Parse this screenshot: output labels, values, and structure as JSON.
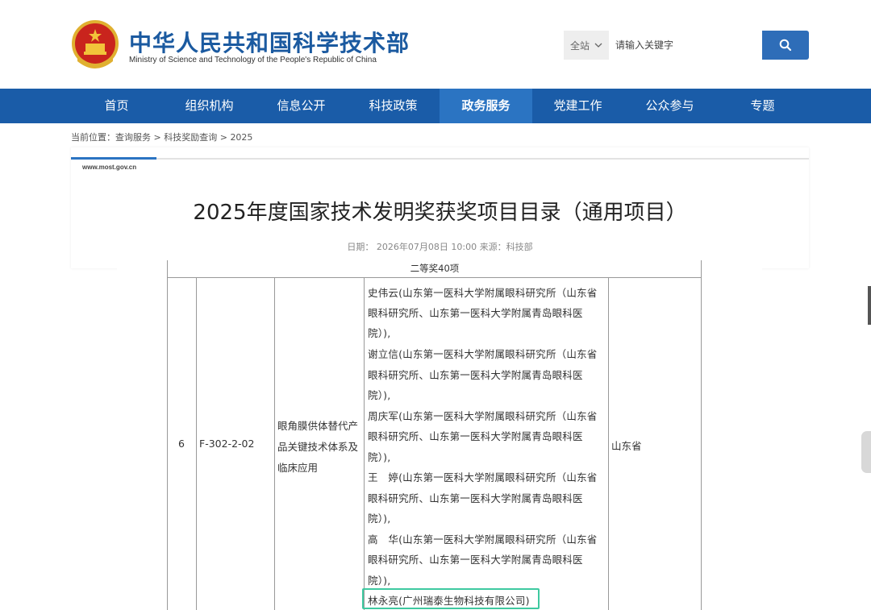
{
  "header": {
    "site_title": "中华人民共和国科学技术部",
    "site_subtitle": "Ministry of Science and Technology of the People's Republic of China",
    "search": {
      "scope": "全站",
      "placeholder": "请输入关键字"
    }
  },
  "nav": {
    "items": [
      {
        "label": "首页"
      },
      {
        "label": "组织机构"
      },
      {
        "label": "信息公开"
      },
      {
        "label": "科技政策"
      },
      {
        "label": "政务服务",
        "active": true
      },
      {
        "label": "党建工作"
      },
      {
        "label": "公众参与"
      },
      {
        "label": "专题"
      }
    ]
  },
  "breadcrumb": {
    "prefix": "当前位置：",
    "items": [
      "查询服务",
      "科技奖励查询",
      "2025"
    ],
    "separator": " > "
  },
  "article": {
    "site_url": "www.most.gov.cn",
    "title": "2025年度国家技术发明奖获奖项目目录（通用项目）",
    "meta": "日期：  2026年07月08日 10:00     来源：科技部"
  },
  "table": {
    "section_header": "二等奖40项",
    "row": {
      "index": "6",
      "code": "F-302-2-02",
      "project_name_lines": [
        "眼角膜供体替代产",
        "品关键技术体系及",
        "临床应用"
      ],
      "nominator": "山东省",
      "person_lines": [
        "史伟云(山东第一医科大学附属眼科研究所（山东省",
        "眼科研究所、山东第一医科大学附属青岛眼科医",
        "院）),",
        "谢立信(山东第一医科大学附属眼科研究所（山东省",
        "眼科研究所、山东第一医科大学附属青岛眼科医",
        "院）),",
        "周庆军(山东第一医科大学附属眼科研究所（山东省",
        "眼科研究所、山东第一医科大学附属青岛眼科医",
        "院）),",
        "王　婷(山东第一医科大学附属眼科研究所（山东省",
        "眼科研究所、山东第一医科大学附属青岛眼科医",
        "院）),",
        "高　华(山东第一医科大学附属眼科研究所（山东省",
        "眼科研究所、山东第一医科大学附属青岛眼科医",
        "院）),",
        "林永亮(广州瑞泰生物科技有限公司)"
      ]
    }
  },
  "colors": {
    "brand_blue": "#1a5ca8",
    "nav_active": "#2b74c2",
    "highlight": "#3ec9a0"
  }
}
